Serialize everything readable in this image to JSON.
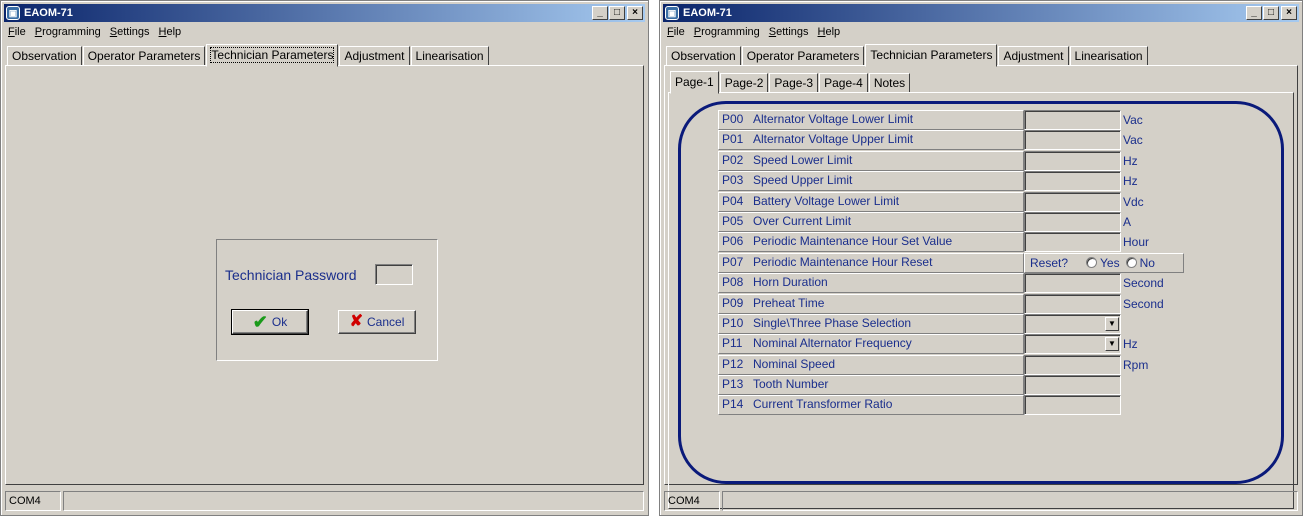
{
  "left_window": {
    "title": "EAOM-71",
    "title_buttons": {
      "minimize": "_",
      "maximize": "□",
      "close": "×"
    },
    "menu": [
      {
        "mnemonic": "F",
        "rest": "ile"
      },
      {
        "mnemonic": "P",
        "rest": "rogramming"
      },
      {
        "mnemonic": "S",
        "rest": "ettings"
      },
      {
        "mnemonic": "H",
        "rest": "elp"
      }
    ],
    "tabs": [
      "Observation",
      "Operator Parameters",
      "Technician Parameters",
      "Adjustment",
      "Linearisation"
    ],
    "active_tab": "Technician Parameters",
    "password_dialog": {
      "label": "Technician Password",
      "value": "",
      "ok_label": "Ok",
      "cancel_label": "Cancel"
    },
    "status": {
      "port": "COM4",
      "message": ""
    }
  },
  "right_window": {
    "title": "EAOM-71",
    "title_buttons": {
      "minimize": "_",
      "maximize": "□",
      "close": "×"
    },
    "menu": [
      {
        "mnemonic": "F",
        "rest": "ile"
      },
      {
        "mnemonic": "P",
        "rest": "rogramming"
      },
      {
        "mnemonic": "S",
        "rest": "ettings"
      },
      {
        "mnemonic": "H",
        "rest": "elp"
      }
    ],
    "tabs": [
      "Observation",
      "Operator Parameters",
      "Technician Parameters",
      "Adjustment",
      "Linearisation"
    ],
    "active_tab": "Technician Parameters",
    "subtabs": [
      "Page-1",
      "Page-2",
      "Page-3",
      "Page-4",
      "Notes"
    ],
    "active_subtab": "Page-1",
    "params": [
      {
        "code": "P00",
        "name": "Alternator Voltage Lower Limit",
        "value": "",
        "unit": "Vac",
        "kind": "text"
      },
      {
        "code": "P01",
        "name": "Alternator Voltage Upper Limit",
        "value": "",
        "unit": "Vac",
        "kind": "text"
      },
      {
        "code": "P02",
        "name": "Speed Lower Limit",
        "value": "",
        "unit": "Hz",
        "kind": "text"
      },
      {
        "code": "P03",
        "name": "Speed Upper Limit",
        "value": "",
        "unit": "Hz",
        "kind": "text"
      },
      {
        "code": "P04",
        "name": "Battery Voltage Lower Limit",
        "value": "",
        "unit": "Vdc",
        "kind": "text"
      },
      {
        "code": "P05",
        "name": "Over Current Limit",
        "value": "",
        "unit": "A",
        "kind": "text"
      },
      {
        "code": "P06",
        "name": "Periodic Maintenance Hour Set Value",
        "value": "",
        "unit": "Hour",
        "kind": "text"
      },
      {
        "code": "P07",
        "name": "Periodic Maintenance Hour Reset",
        "kind": "reset",
        "reset_label": "Reset?",
        "yes_label": "Yes",
        "no_label": "No"
      },
      {
        "code": "P08",
        "name": "Horn Duration",
        "value": "",
        "unit": "Second",
        "kind": "text"
      },
      {
        "code": "P09",
        "name": "Preheat Time",
        "value": "",
        "unit": "Second",
        "kind": "text"
      },
      {
        "code": "P10",
        "name": "Single\\Three Phase Selection",
        "value": "",
        "unit": "",
        "kind": "select"
      },
      {
        "code": "P11",
        "name": "Nominal Alternator Frequency",
        "value": "",
        "unit": "Hz",
        "kind": "select"
      },
      {
        "code": "P12",
        "name": "Nominal Speed",
        "value": "",
        "unit": "Rpm",
        "kind": "text"
      },
      {
        "code": "P13",
        "name": "Tooth Number",
        "value": "",
        "unit": "",
        "kind": "text"
      },
      {
        "code": "P14",
        "name": "Current Transformer Ratio",
        "value": "",
        "unit": "",
        "kind": "text"
      }
    ],
    "status": {
      "port": "COM4",
      "message": ""
    }
  },
  "colors": {
    "window_bg": "#d4d0c8",
    "title_gradient_start": "#0a246a",
    "title_gradient_end": "#a6caf0",
    "label_text": "#1a2e8c",
    "frame_border": "#0a1a7a",
    "ok_icon": "#1a9a1a",
    "cancel_icon": "#d00000"
  },
  "icons": {
    "app": "app-icon",
    "ok": "check-icon",
    "cancel": "x-icon",
    "dropdown": "chevron-down-icon"
  }
}
